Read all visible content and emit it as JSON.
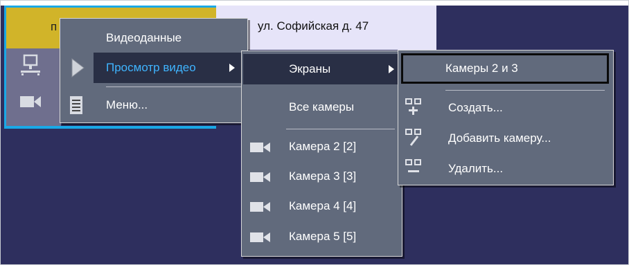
{
  "tabs": {
    "left_label": "п",
    "right_label": "ул. Софийская д. 47"
  },
  "colors": {
    "background": "#2e2f5e",
    "tab_active": "#d1b429",
    "selection_border": "#1aa8e6",
    "tab_inactive": "#e6e4f9",
    "menu_bg": "#616a7c",
    "menu_highlight": "#292f45"
  },
  "strip_icons": [
    "network-icon",
    "camera-icon"
  ],
  "context_menu": {
    "items": [
      {
        "label": "Видеоданные",
        "icon": null
      },
      {
        "label": "Просмотр видео",
        "icon": "play-triangle-icon",
        "submenu": true,
        "highlighted": true
      },
      {
        "label": "Меню...",
        "icon": "document-icon"
      }
    ]
  },
  "video_submenu": {
    "items": [
      {
        "label": "Экраны",
        "submenu": true,
        "highlighted": true
      },
      {
        "label": "Все камеры"
      },
      {
        "label": "Камера 2 [2]",
        "icon": "camera-icon"
      },
      {
        "label": "Камера 3 [3]",
        "icon": "camera-icon"
      },
      {
        "label": "Камера 4 [4]",
        "icon": "camera-icon"
      },
      {
        "label": "Камера 5 [5]",
        "icon": "camera-icon"
      }
    ]
  },
  "screens_submenu": {
    "items": [
      {
        "label": "Камеры 2 и 3",
        "highlighted": true
      },
      {
        "label": "Создать...",
        "icon": "create-screen-icon"
      },
      {
        "label": "Добавить камеру...",
        "icon": "add-camera-icon"
      },
      {
        "label": "Удалить...",
        "icon": "delete-screen-icon"
      }
    ]
  }
}
